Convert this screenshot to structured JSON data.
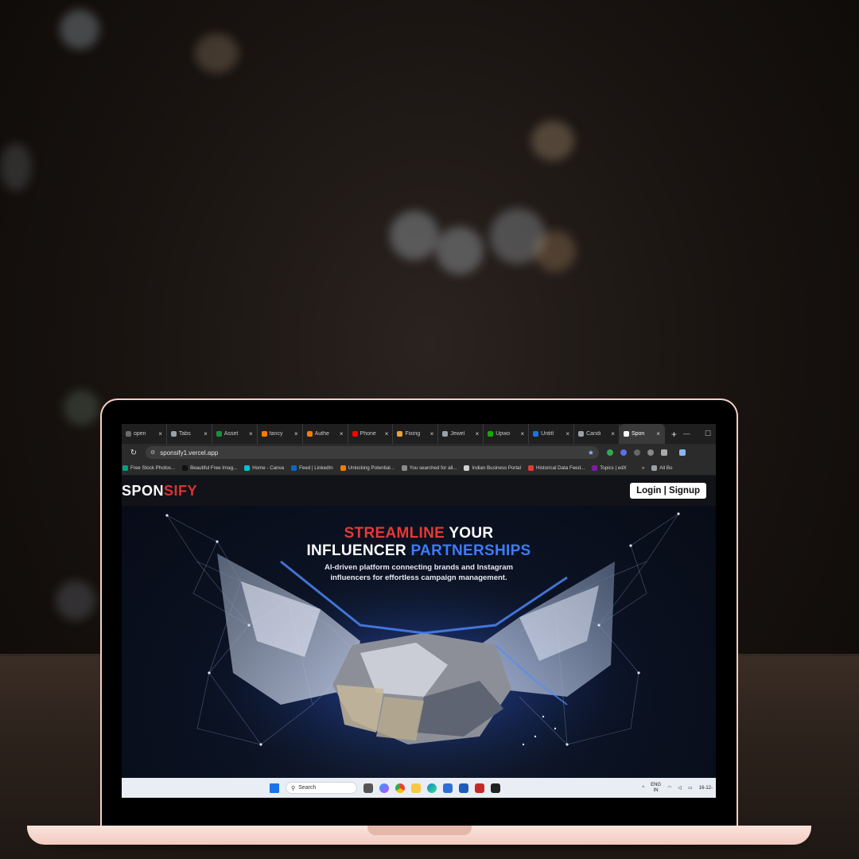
{
  "browser": {
    "tabs": [
      {
        "label": "open",
        "color": "#6b6b6b"
      },
      {
        "label": "Tabs",
        "color": "#9aa0a6"
      },
      {
        "label": "Asset",
        "color": "#1e8e3e"
      },
      {
        "label": "fancy",
        "color": "#f57c00"
      },
      {
        "label": "Authe",
        "color": "#f57c00"
      },
      {
        "label": "Phone",
        "color": "#ff0000"
      },
      {
        "label": "Fixing",
        "color": "#e8a33d"
      },
      {
        "label": "Jewel",
        "color": "#9aa0a6"
      },
      {
        "label": "Upwo",
        "color": "#14a800"
      },
      {
        "label": "Untitl",
        "color": "#1a73e8"
      },
      {
        "label": "Candi",
        "color": "#9aa0a6"
      },
      {
        "label": "Spon",
        "color": "#ffffff",
        "active": true
      }
    ],
    "new_tab": "+",
    "reload_icon": "↻",
    "url": "sponsify1.vercel.app",
    "bookmarks": [
      {
        "label": "Free Stock Photos...",
        "color": "#05a081"
      },
      {
        "label": "Beautiful Free Imag...",
        "color": "#111111"
      },
      {
        "label": "Home - Canva",
        "color": "#00c4cc"
      },
      {
        "label": "Feed | LinkedIn",
        "color": "#0a66c2"
      },
      {
        "label": "Unlocking Potential...",
        "color": "#f57c00"
      },
      {
        "label": "You searched for all...",
        "color": "#8a8a8a"
      },
      {
        "label": "Indian Business Portal",
        "color": "#d0d0d0"
      },
      {
        "label": "Historical Data Feed...",
        "color": "#e53935"
      },
      {
        "label": "Topics | edX",
        "color": "#7b1fa2"
      },
      {
        "label": "»",
        "color": "#2b2b2b"
      },
      {
        "label": "All Bo",
        "color": "#9aa0a6"
      }
    ]
  },
  "site": {
    "logo_part1": "SPON",
    "logo_part2": "SIFY",
    "auth_button": "Login | Signup",
    "headline_line1_red": "STREAMLINE",
    "headline_line1_white": " YOUR",
    "headline_line2_white": "INFLUENCER ",
    "headline_line2_blue": "PARTNERSHIPS",
    "subtitle_line1": "AI-driven platform connecting brands and Instagram",
    "subtitle_line2": "influencers for effortless campaign management.",
    "hero_image": "low-poly-handshake"
  },
  "taskbar": {
    "search_placeholder": "Search",
    "lang_line1": "ENG",
    "lang_line2": "IN",
    "date": "16-12-"
  }
}
